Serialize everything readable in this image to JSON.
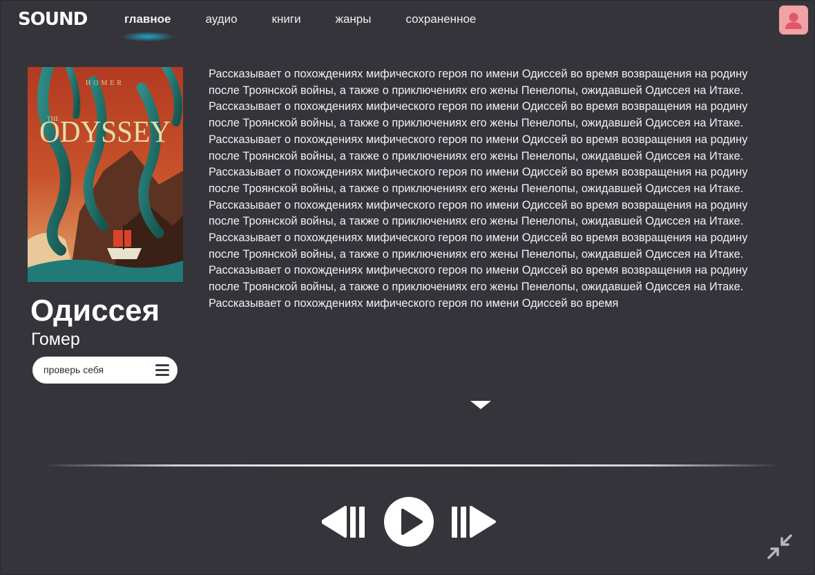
{
  "app": {
    "logo": "SOUND"
  },
  "nav": {
    "items": [
      {
        "label": "главное",
        "active": true
      },
      {
        "label": "аудио"
      },
      {
        "label": "книги"
      },
      {
        "label": "жанры"
      },
      {
        "label": "сохраненное"
      }
    ]
  },
  "book": {
    "cover_author": "HOMER",
    "cover_the": "THE",
    "cover_title": "ODYSSEY",
    "title": "Одиссея",
    "author": "Гомер",
    "quiz_label": "проверь себя",
    "description": "Рассказывает о похождениях мифического героя по имени Одиссей во время возвращения на родину после Троянской войны, а также о приключениях его жены Пенелопы, ожидавшей Одиссея на Итаке. Рассказывает о похождениях мифического героя по имени Одиссей во время возвращения на родину после Троянской войны, а также о приключениях его жены Пенелопы, ожидавшей Одиссея на Итаке. Рассказывает о похождениях мифического героя по имени Одиссей во время возвращения на родину после Троянской войны, а также о приключениях его жены Пенелопы, ожидавшей Одиссея на Итаке. Рассказывает о похождениях мифического героя по имени Одиссей во время возвращения на родину после Троянской войны, а также о приключениях его жены Пенелопы, ожидавшей Одиссея на Итаке. Рассказывает о похождениях мифического героя по имени Одиссей во время возвращения на родину после Троянской войны, а также о приключениях его жены Пенелопы, ожидавшей Одиссея на Итаке. Рассказывает о похождениях мифического героя по имени Одиссей во время возвращения на родину после Троянской войны, а также о приключениях его жены Пенелопы, ожидавшей Одиссея на Итаке. Рассказывает о похождениях мифического героя по имени Одиссей во время возвращения на родину после Троянской войны, а также о приключениях его жены Пенелопы, ожидавшей Одиссея на Итаке. Рассказывает о похождениях мифического героя по имени Одиссей во время"
  },
  "icons": {
    "avatar": "user-avatar-icon",
    "quiz_menu": "menu-lines-icon",
    "expand": "chevron-down-icon",
    "rewind": "rewind-icon",
    "play": "play-icon",
    "forward": "fast-forward-icon",
    "collapse": "collapse-arrows-icon"
  },
  "colors": {
    "background": "#35343b",
    "accent_glow": "#1ea3c2",
    "avatar_bg": "#f1a2a4",
    "avatar_fg": "#e0566a",
    "text": "#ffffff",
    "button_bg": "#ffffff"
  }
}
